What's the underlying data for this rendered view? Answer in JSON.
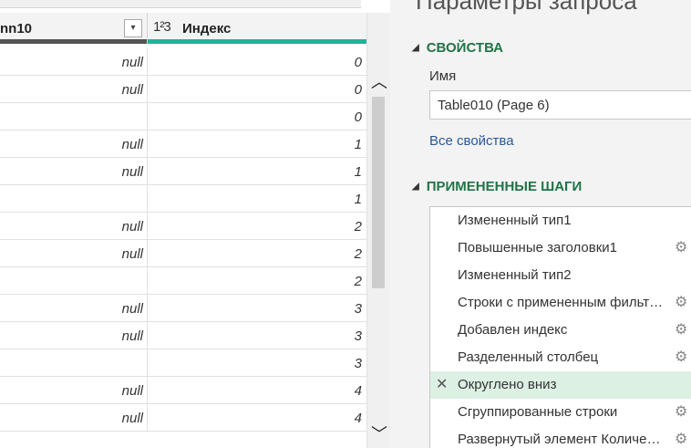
{
  "grid": {
    "columns": [
      {
        "name": "nn10",
        "type_icon": ""
      },
      {
        "name": "Индекс",
        "type_icon": "1²3"
      }
    ],
    "dropdown_icon": "▾",
    "rows": [
      {
        "c1": "null",
        "c2": "0"
      },
      {
        "c1": "null",
        "c2": "0"
      },
      {
        "c1": "",
        "c2": "0"
      },
      {
        "c1": "null",
        "c2": "1"
      },
      {
        "c1": "null",
        "c2": "1"
      },
      {
        "c1": "",
        "c2": "1"
      },
      {
        "c1": "null",
        "c2": "2"
      },
      {
        "c1": "null",
        "c2": "2"
      },
      {
        "c1": "",
        "c2": "2"
      },
      {
        "c1": "null",
        "c2": "3"
      },
      {
        "c1": "null",
        "c2": "3"
      },
      {
        "c1": "",
        "c2": "3"
      },
      {
        "c1": "null",
        "c2": "4"
      },
      {
        "c1": "null",
        "c2": "4"
      }
    ]
  },
  "scrollbar": {
    "up_icon": "︿",
    "down_icon": "﹀"
  },
  "pane": {
    "title": "Параметры запроса",
    "properties": {
      "section_label": "СВОЙСТВА",
      "name_label": "Имя",
      "name_value": "Table010 (Page 6)",
      "all_properties_link": "Все свойства"
    },
    "steps_section_label": "ПРИМЕНЕННЫЕ ШАГИ",
    "steps": [
      {
        "label": "Измененный тип1",
        "gear": false,
        "selected": false
      },
      {
        "label": "Повышенные заголовки1",
        "gear": true,
        "selected": false
      },
      {
        "label": "Измененный тип2",
        "gear": false,
        "selected": false
      },
      {
        "label": "Строки с примененным фильтром",
        "gear": true,
        "selected": false
      },
      {
        "label": "Добавлен индекс",
        "gear": true,
        "selected": false
      },
      {
        "label": "Разделенный столбец",
        "gear": true,
        "selected": false
      },
      {
        "label": "Округлено вниз",
        "gear": false,
        "selected": true
      },
      {
        "label": "Сгруппированные строки",
        "gear": true,
        "selected": false
      },
      {
        "label": "Развернутый элемент Количество",
        "gear": true,
        "selected": false
      }
    ],
    "icons": {
      "collapse": "◢",
      "gear": "⚙",
      "delete": "✕"
    },
    "colors": {
      "section": "#217346",
      "link": "#2b5797",
      "selected_step": "#dcf0e4",
      "index_bar": "#1eb49b"
    }
  }
}
